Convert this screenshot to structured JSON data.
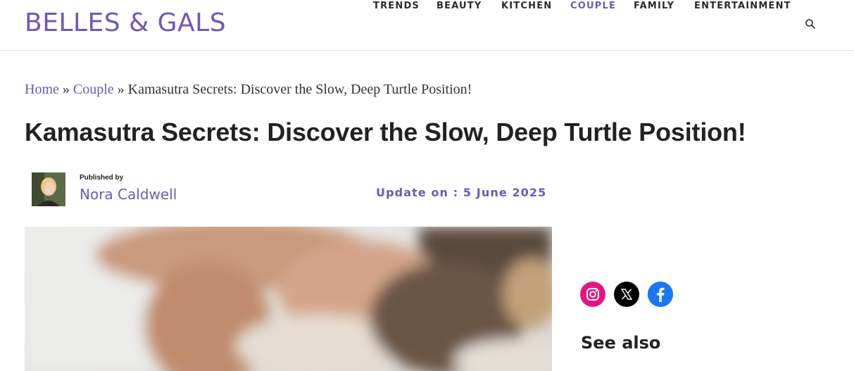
{
  "header": {
    "logo": "BELLES & GALS",
    "nav": [
      {
        "label": "TRENDS",
        "active": false
      },
      {
        "label": "BEAUTY",
        "active": false
      },
      {
        "label": "KITCHEN",
        "active": false
      },
      {
        "label": "COUPLE",
        "active": true
      },
      {
        "label": "FAMILY",
        "active": false
      },
      {
        "label": "ENTERTAINMENT",
        "active": false
      }
    ],
    "search_icon": "search-icon"
  },
  "breadcrumb": {
    "home": "Home",
    "sep1": "»",
    "category": "Couple",
    "sep2": "»",
    "current": "Kamasutra Secrets: Discover the Slow, Deep Turtle Position!"
  },
  "article": {
    "title": "Kamasutra Secrets: Discover the Slow, Deep Turtle Position!",
    "published_by_label": "Published by",
    "author": "Nora Caldwell",
    "update": "Update on : 5 June 2025"
  },
  "sidebar": {
    "social": [
      {
        "name": "instagram-icon",
        "color": "#e4157e"
      },
      {
        "name": "x-icon",
        "color": "#000000"
      },
      {
        "name": "facebook-icon",
        "color": "#1877f2"
      }
    ],
    "see_also": "See also"
  },
  "colors": {
    "accent": "#6f58b8",
    "text": "#222222"
  }
}
